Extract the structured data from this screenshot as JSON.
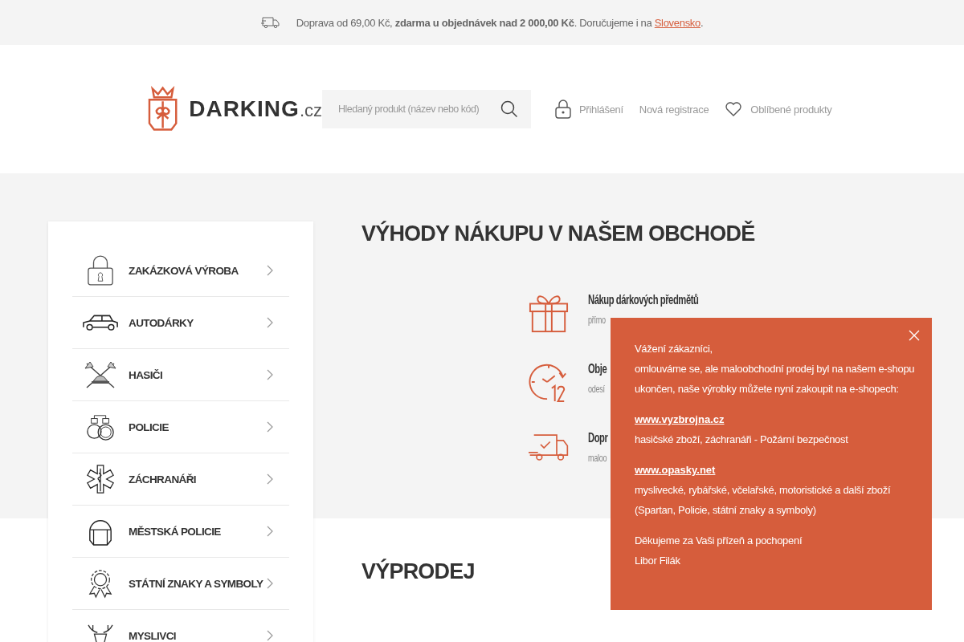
{
  "top_bar": {
    "text": "Doprava od 69,00 Kč, **zdarma u objednávek nad 2 000,00 Kč**. Doručujeme i na",
    "link": "Slovensko",
    "after": "."
  },
  "header": {
    "logo": {
      "name": "DARKING",
      "suffix": ".cz"
    },
    "search": {
      "placeholder": "Hledaný produkt (název nebo kód)"
    },
    "links": [
      {
        "kind": "lock",
        "label": "Přihlášení"
      },
      {
        "kind": "plain",
        "label": "Nová registrace"
      },
      {
        "kind": "heart",
        "label": "Oblíbené produkty"
      }
    ]
  },
  "categories": [
    {
      "kind": "padlock",
      "label": "ZAKÁZKOVÁ VÝROBA"
    },
    {
      "kind": "car",
      "label": "AUTODÁRKY"
    },
    {
      "kind": "axes",
      "label": "HASIČI"
    },
    {
      "kind": "handcuffs",
      "label": "POLICIE"
    },
    {
      "kind": "star",
      "label": "ZÁCHRANÁŘI"
    },
    {
      "kind": "helmet",
      "label": "MĚSTSKÁ POLICIE"
    },
    {
      "kind": "medal",
      "label": "STÁTNÍ ZNAKY A SYMBOLY"
    },
    {
      "kind": "deer",
      "label": "MYSLIVCI"
    }
  ],
  "benefits": {
    "heading": "VÝHODY NÁKUPU V NAŠEM OBCHODĚ",
    "items": [
      {
        "kind": "gift",
        "title": "Nákup dárkových předmětů",
        "subtitle": "přímo"
      },
      {
        "kind": "clock",
        "title": "Obje",
        "subtitle": "odesí"
      },
      {
        "kind": "truck",
        "title": "Dopr",
        "subtitle": "maloo"
      }
    ]
  },
  "sale": {
    "heading": "VÝPRODEJ"
  },
  "popup": {
    "blocks": [
      [
        {
          "kind": "text",
          "text": "Vážení zákazníci,"
        },
        {
          "kind": "text",
          "text": "omlouváme se, ale maloobchodní prodej byl na našem e-shopu"
        },
        {
          "kind": "text",
          "text": "ukončen, naše výrobky můžete nyní zakoupit na e-shopech:"
        }
      ],
      [
        {
          "kind": "link",
          "text": "www.vyzbrojna.cz"
        },
        {
          "kind": "text",
          "text": "hasičské zboží, záchranáři - Požární bezpečnost"
        }
      ],
      [
        {
          "kind": "link",
          "text": "www.opasky.net"
        },
        {
          "kind": "text",
          "text": "myslivecké, rybářské, včelařské, motoristické a další zboží"
        },
        {
          "kind": "text",
          "text": "(Spartan, Policie, státní znaky a symboly)"
        }
      ],
      [
        {
          "kind": "text",
          "text": "Děkujeme za Vaši přízeň a pochopení"
        },
        {
          "kind": "text",
          "text": "Libor Filák"
        }
      ]
    ]
  }
}
